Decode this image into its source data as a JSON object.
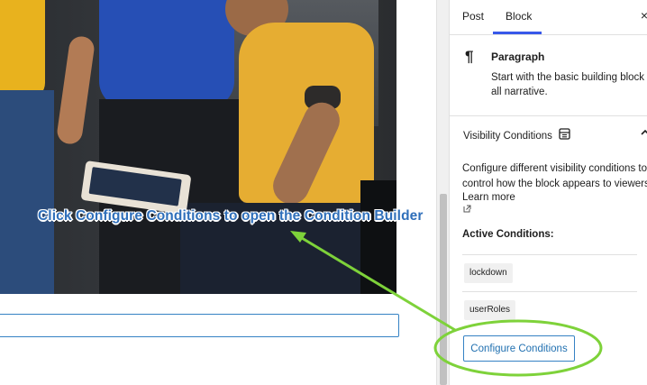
{
  "sidebar": {
    "tabs": [
      {
        "label": "Post"
      },
      {
        "label": "Block"
      }
    ],
    "close_glyph": "×",
    "block": {
      "icon": "paragraph-icon",
      "title": "Paragraph",
      "description_line1": "Start with the basic building block o",
      "description_line2": "all narrative."
    },
    "visibility": {
      "title": "Visibility Conditions",
      "description_line1": "Configure different visibility conditions to",
      "description_line2": "control how the block appears to viewers.",
      "learn_more": "Learn more",
      "active_title": "Active Conditions:",
      "conditions": [
        "lockdown",
        "userRoles"
      ],
      "configure_label": "Configure Conditions"
    }
  },
  "annotation": {
    "text": "Click Configure Conditions to open the Condition Builder",
    "color": "#2f6fba",
    "highlight_color": "#7ed23a"
  }
}
